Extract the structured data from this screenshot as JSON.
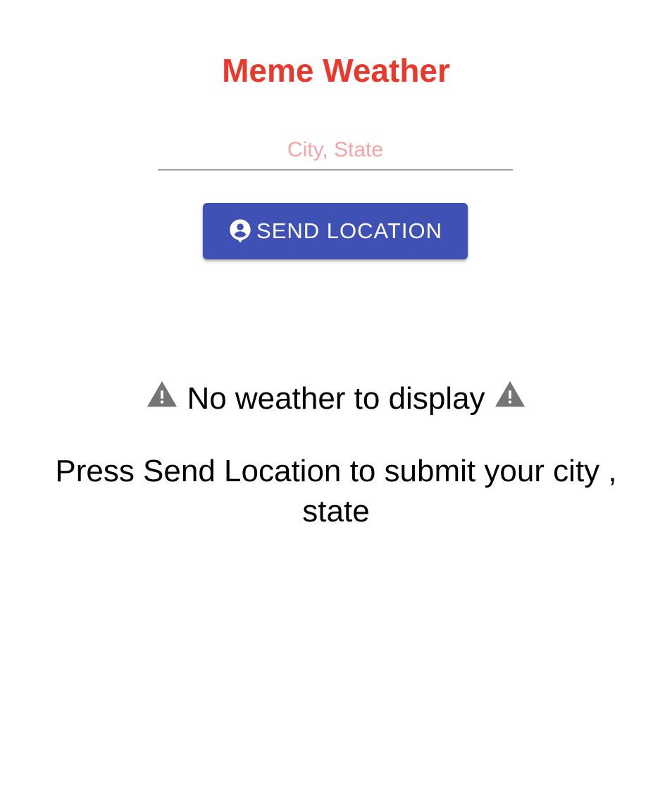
{
  "app": {
    "title": "Meme Weather"
  },
  "search": {
    "placeholder": "City, State",
    "value": ""
  },
  "send_button": {
    "label": "SEND LOCATION",
    "icon": "person-pin-icon"
  },
  "empty_state": {
    "icon": "warning-icon",
    "message": "No weather to display",
    "hint": "Press Send Location to submit your city , state"
  },
  "colors": {
    "title": "#e8392c",
    "button_bg": "#3f51b5",
    "placeholder": "#f2a6a6",
    "warning_icon": "#757575"
  }
}
